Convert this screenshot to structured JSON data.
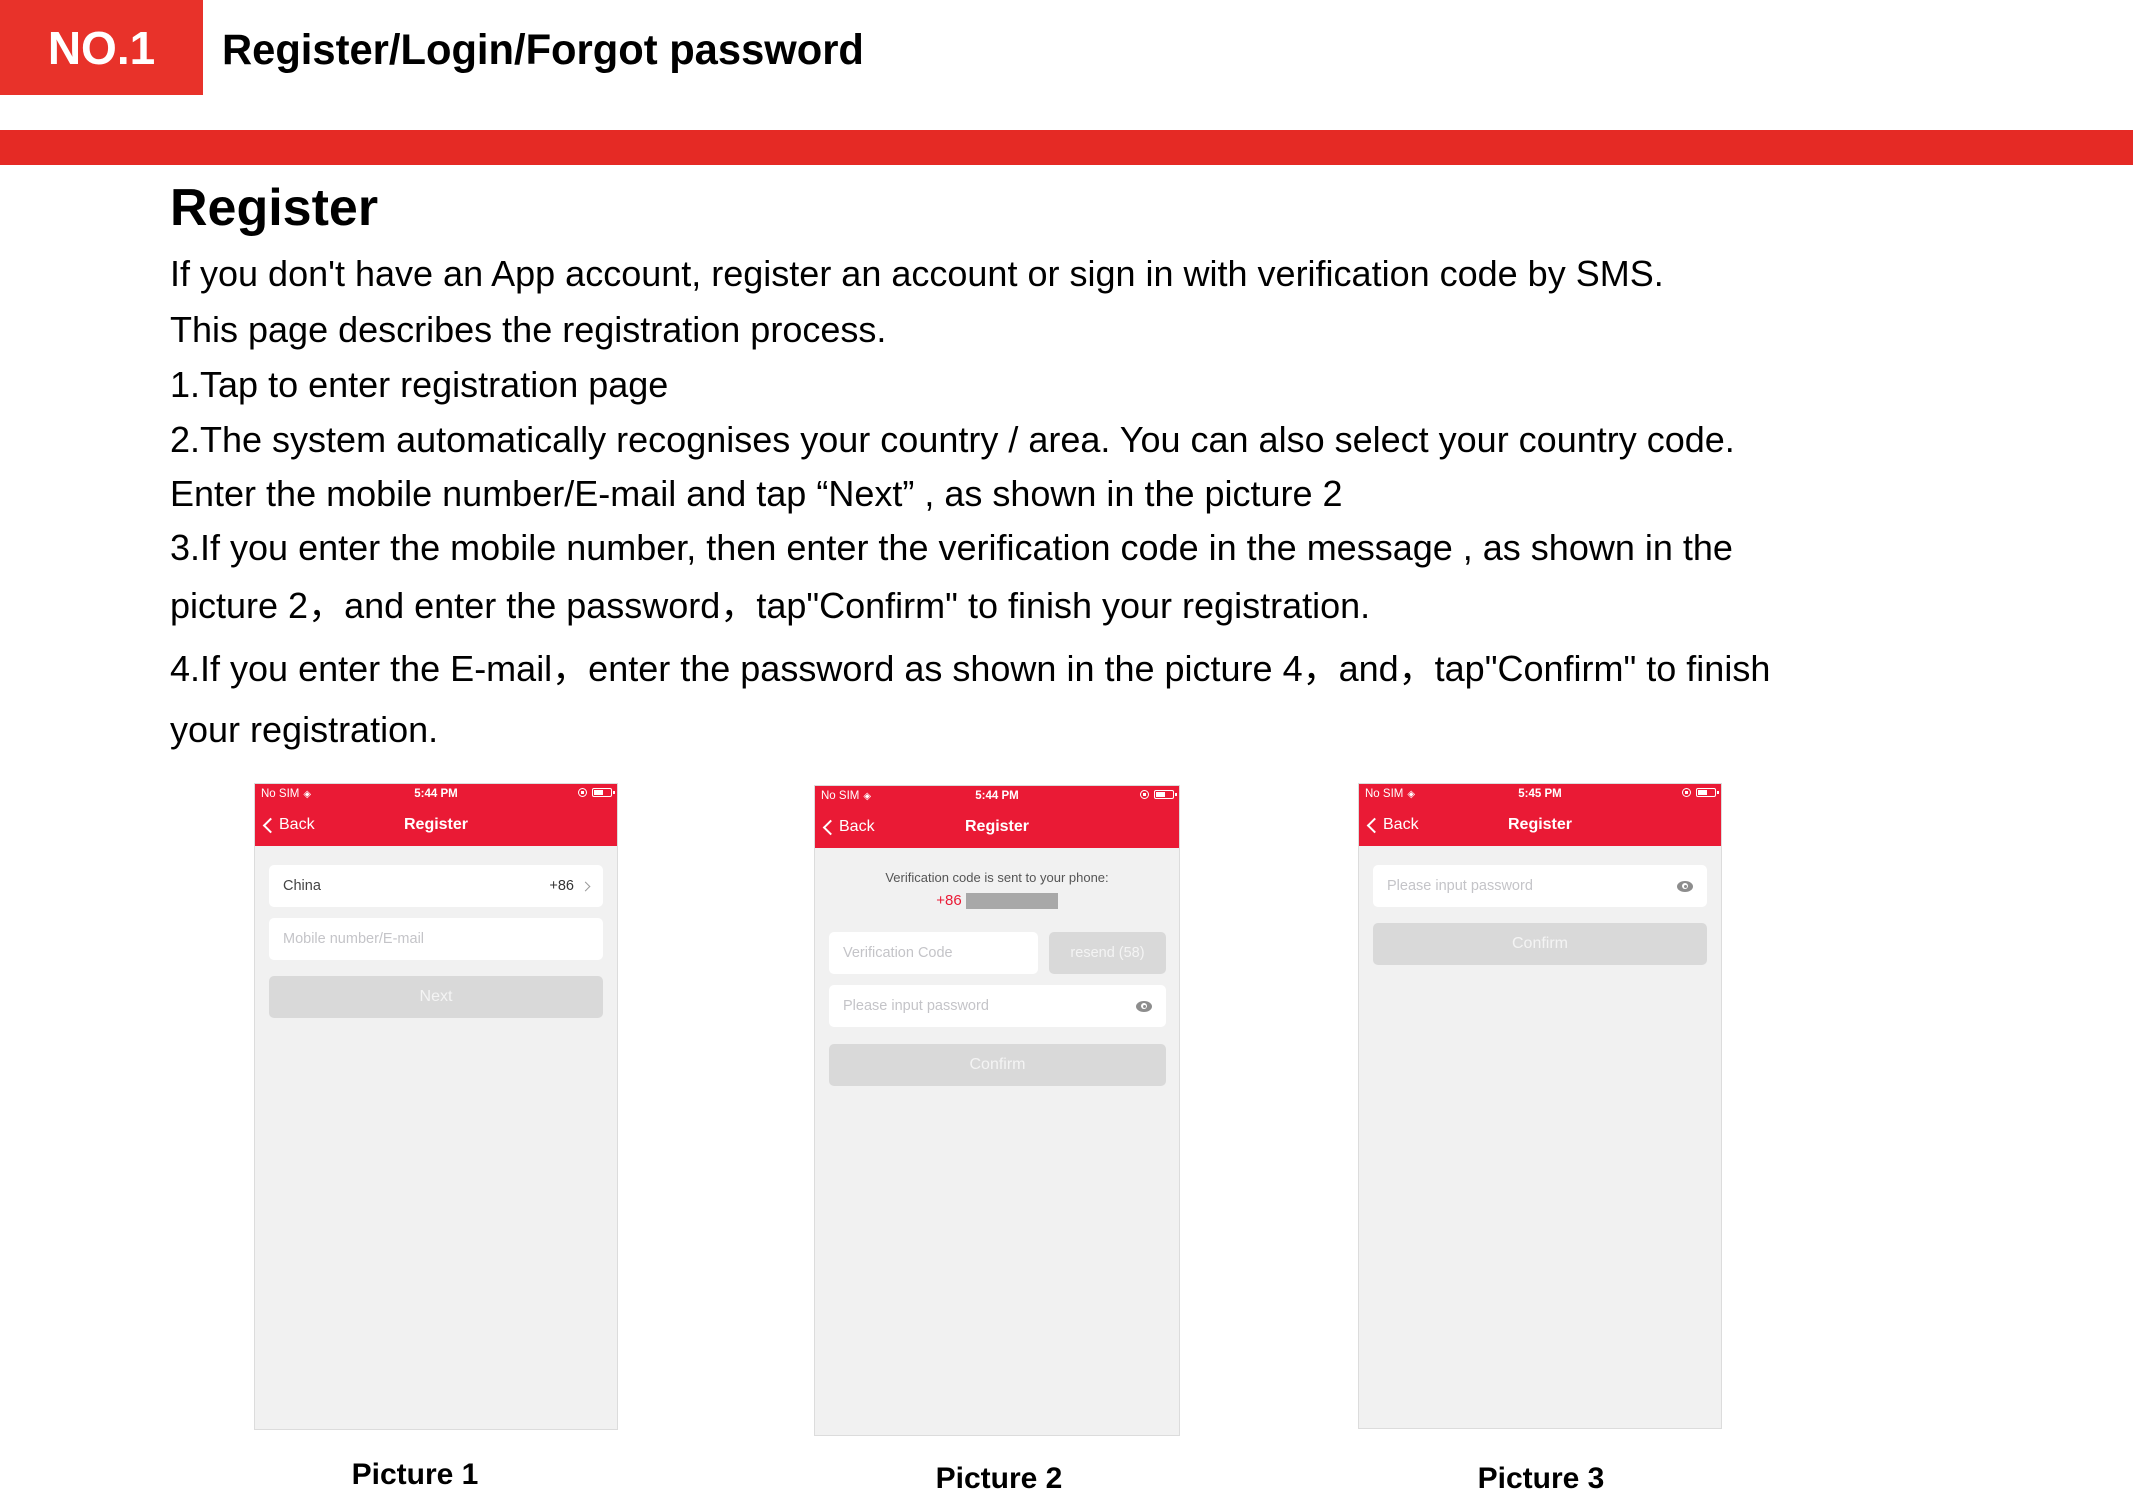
{
  "header": {
    "badge": "NO.1",
    "title": "Register/Login/Forgot password"
  },
  "colors": {
    "accent": "#e52a25",
    "app_header": "#ea1a35",
    "disabled_button": "#d9d9d9",
    "screen_background": "#f1f1f1"
  },
  "section": {
    "heading": "Register",
    "lines": [
      "If you don't have an App account, register an account or sign in with verification code by SMS.",
      "This page describes the registration process.",
      "1.Tap to enter registration page",
      "2.The system automatically recognises your country / area. You can also select your country code.",
      "Enter the mobile number/E-mail and tap “Next” , as shown in the picture 2",
      "3.If you enter the mobile number, then enter the verification code in the message , as shown in the",
      "picture 2，and enter the password，tap\"Confirm\" to finish your registration.",
      "4.If you enter the E-mail，enter the password as shown in the picture 4，and，tap\"Confirm\" to finish",
      "your registration."
    ]
  },
  "pictures": [
    {
      "caption": "Picture 1",
      "status": {
        "carrier": "No SIM",
        "time": "5:44 PM"
      },
      "nav": {
        "back": "Back",
        "title": "Register"
      },
      "country_row": {
        "country": "China",
        "code": "+86"
      },
      "contact_input": {
        "placeholder": "Mobile number/E-mail",
        "value": ""
      },
      "next_button": "Next"
    },
    {
      "caption": "Picture 2",
      "status": {
        "carrier": "No SIM",
        "time": "5:44 PM"
      },
      "nav": {
        "back": "Back",
        "title": "Register"
      },
      "sent_message": "Verification code is sent to your phone:",
      "phone_prefix": "+86",
      "code_input": {
        "placeholder": "Verification Code",
        "value": ""
      },
      "resend_button": "resend (58)",
      "password_input": {
        "placeholder": "Please input password",
        "value": ""
      },
      "confirm_button": "Confirm"
    },
    {
      "caption": "Picture 3",
      "status": {
        "carrier": "No SIM",
        "time": "5:45 PM"
      },
      "nav": {
        "back": "Back",
        "title": "Register"
      },
      "password_input": {
        "placeholder": "Please input password",
        "value": ""
      },
      "confirm_button": "Confirm"
    }
  ],
  "icons": {
    "wifi": "wifi-icon",
    "rotation_lock": "rotation-lock-icon",
    "battery": "battery-icon",
    "back_chevron": "chevron-left-icon",
    "country_chevron": "chevron-right-icon",
    "password_visibility": "eye-icon"
  }
}
